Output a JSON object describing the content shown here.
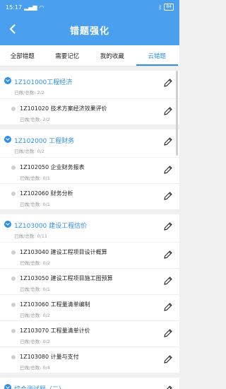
{
  "status": {
    "time": "15:17",
    "battery": "84"
  },
  "header": {
    "title": "错题强化"
  },
  "tabs": [
    {
      "label": "全部错题",
      "active": false
    },
    {
      "label": "需要记忆",
      "active": false
    },
    {
      "label": "我的收藏",
      "active": false
    },
    {
      "label": "云错题",
      "active": true
    }
  ],
  "sections": [
    {
      "title": "1Z101000工程经济",
      "stats": "已做/总数: 2/2",
      "items": [
        {
          "title": "1Z101020 技术方案经济效果评价",
          "stats": "已做/总数: 2/2"
        }
      ]
    },
    {
      "title": "1Z102000 工程财务",
      "stats": "已做/总数: 0/2",
      "items": [
        {
          "title": "1Z102050 企业财务报表",
          "stats": "已做/总数: 0/1"
        },
        {
          "title": "1Z102060 财务分析",
          "stats": "已做/总数: 0/1"
        }
      ]
    },
    {
      "title": "1Z103000 建设工程估价",
      "stats": "已做/总数: 0/11",
      "items": [
        {
          "title": "1Z103040 建设工程项目设计概算",
          "stats": "已做/总数: 0/2"
        },
        {
          "title": "1Z103050 建设工程项目施工图预算",
          "stats": "已做/总数: 0/1"
        },
        {
          "title": "1Z103060 工程量清单编制",
          "stats": "已做/总数: 0/2"
        },
        {
          "title": "1Z103070 工程量清单计价",
          "stats": "已做/总数: 0/2"
        },
        {
          "title": "1Z103080 计量与支付",
          "stats": "已做/总数: 0/4"
        }
      ]
    },
    {
      "title": "综合测试题（二）",
      "stats": "",
      "items": []
    }
  ]
}
